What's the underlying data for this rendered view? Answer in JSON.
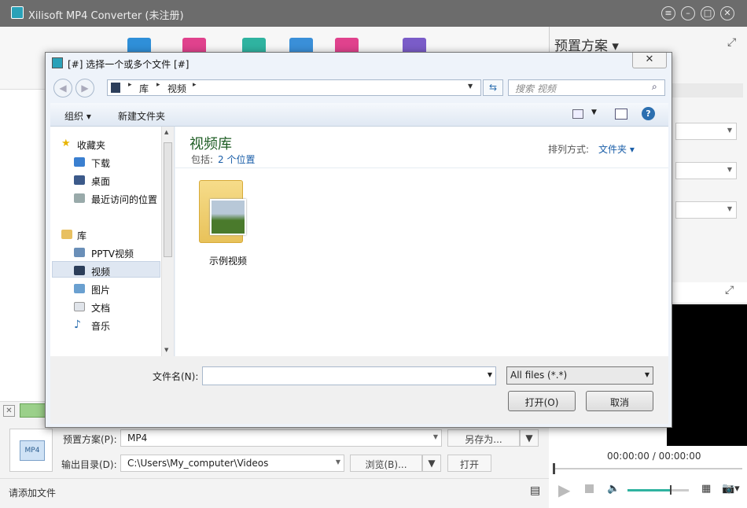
{
  "app": {
    "title": "Xilisoft MP4 Converter (未注册)"
  },
  "right": {
    "preset_title": "预置方案"
  },
  "preview": {
    "time": "00:00:00 / 00:00:00"
  },
  "bottom": {
    "preset_label": "预置方案(P):",
    "preset_value": "MP4",
    "save_as": "另存为...",
    "output_label": "输出目录(D):",
    "output_value": "C:\\Users\\My_computer\\Videos",
    "browse": "浏览(B)...",
    "open": "打开",
    "status": "请添加文件",
    "mp4_badge": "MP4"
  },
  "dialog": {
    "title": "[#] 选择一个或多个文件 [#]",
    "close": "✕",
    "breadcrumb": [
      "库",
      "视频"
    ],
    "search_placeholder": "搜索 视频",
    "organize": "组织",
    "new_folder": "新建文件夹",
    "nav": {
      "favorites": "收藏夹",
      "downloads": "下载",
      "desktop": "桌面",
      "recent": "最近访问的位置",
      "libraries": "库",
      "pptv": "PPTV视频",
      "videos": "视频",
      "pictures": "图片",
      "docs": "文档",
      "music": "音乐"
    },
    "library_title": "视频库",
    "includes_label": "包括:",
    "includes_value": "2 个位置",
    "sort_label": "排列方式:",
    "sort_value": "文件夹",
    "folder_name": "示例视频",
    "filename_label": "文件名(N):",
    "filename_value": "",
    "filetype": "All files (*.*)",
    "open": "打开(O)",
    "cancel": "取消"
  }
}
